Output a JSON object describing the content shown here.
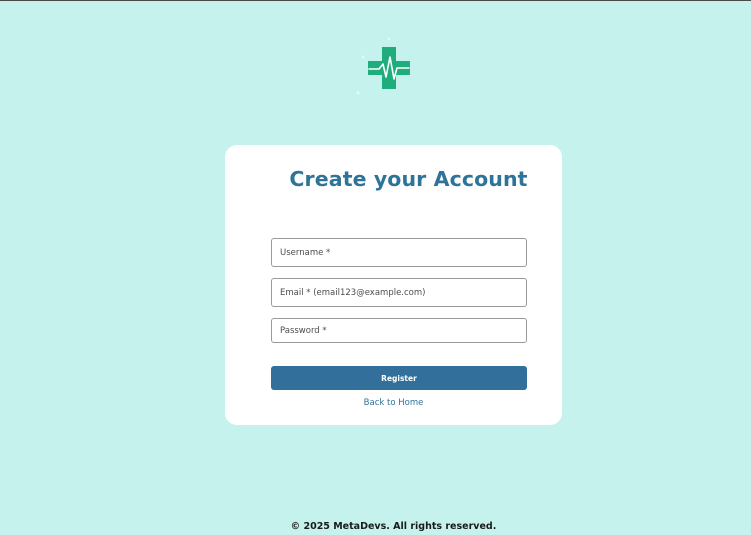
{
  "logo": {
    "icon": "medical-cross-heartbeat-icon",
    "colors": {
      "cross": "#1fad7e",
      "line": "#ffffff",
      "dots": "#e3fbf8"
    }
  },
  "card": {
    "title": "Create your Account",
    "fields": {
      "username_placeholder": "Username *",
      "email_placeholder": "Email * (email123@example.com)",
      "password_placeholder": "Password *"
    },
    "register_label": "Register",
    "back_link": "Back to Home"
  },
  "footer": {
    "text": "© 2025 MetaDevs. All rights reserved."
  },
  "colors": {
    "background": "#c6f2ed",
    "card": "#ffffff",
    "accent": "#2e7398",
    "button": "#32709b"
  }
}
